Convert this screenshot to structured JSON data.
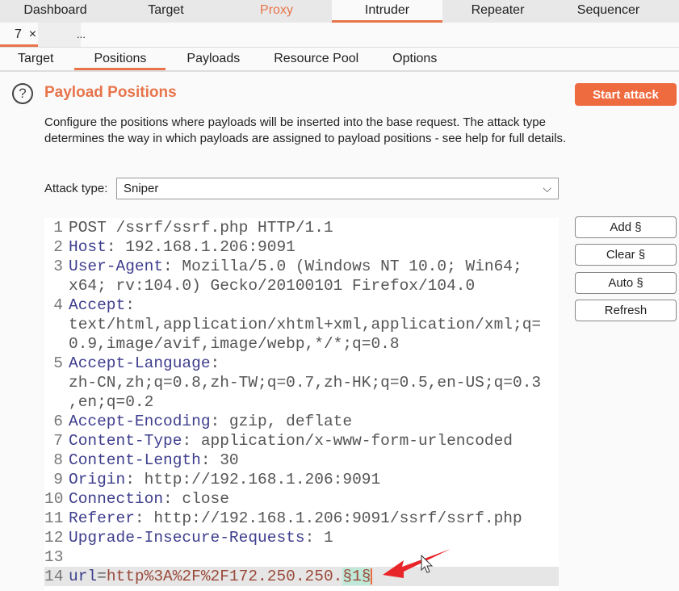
{
  "top_tabs": [
    "Dashboard",
    "Target",
    "Proxy",
    "Intruder",
    "Repeater",
    "Sequencer"
  ],
  "instance_tabs": {
    "current": "7",
    "close": "×",
    "more": "..."
  },
  "nav_tabs": [
    "Target",
    "Positions",
    "Payloads",
    "Resource Pool",
    "Options"
  ],
  "section": {
    "help_icon": "?",
    "title": "Payload Positions",
    "start_label": "Start attack",
    "description": "Configure the positions where payloads will be inserted into the base request. The attack type determines the way in which payloads are assigned to payload positions - see help for full details."
  },
  "attack_type": {
    "label": "Attack type:",
    "value": "Sniper"
  },
  "buttons": [
    "Add §",
    "Clear §",
    "Auto §",
    "Refresh"
  ],
  "colors": {
    "accent": "#e8744a",
    "payload_bg": "#bfe8d8"
  },
  "request_rows": [
    {
      "n": "1",
      "s": [
        [
          "val",
          "POST /ssrf/ssrf.php HTTP/1.1"
        ]
      ]
    },
    {
      "n": "2",
      "s": [
        [
          "key",
          "Host"
        ],
        [
          "val",
          ": 192.168.1.206:9091"
        ]
      ]
    },
    {
      "n": "3",
      "s": [
        [
          "key",
          "User-Agent"
        ],
        [
          "val",
          ": Mozilla/5.0 (Windows NT 10.0; Win64;"
        ]
      ]
    },
    {
      "n": "",
      "s": [
        [
          "val",
          "x64; rv:104.0) Gecko/20100101 Firefox/104.0"
        ]
      ]
    },
    {
      "n": "4",
      "s": [
        [
          "key",
          "Accept"
        ],
        [
          "val",
          ":"
        ]
      ]
    },
    {
      "n": "",
      "s": [
        [
          "val",
          "text/html,application/xhtml+xml,application/xml;q="
        ]
      ]
    },
    {
      "n": "",
      "s": [
        [
          "val",
          "0.9,image/avif,image/webp,*/*;q=0.8"
        ]
      ]
    },
    {
      "n": "5",
      "s": [
        [
          "key",
          "Accept-Language"
        ],
        [
          "val",
          ":"
        ]
      ]
    },
    {
      "n": "",
      "s": [
        [
          "val",
          "zh-CN,zh;q=0.8,zh-TW;q=0.7,zh-HK;q=0.5,en-US;q=0.3"
        ]
      ]
    },
    {
      "n": "",
      "s": [
        [
          "val",
          ",en;q=0.2"
        ]
      ]
    },
    {
      "n": "6",
      "s": [
        [
          "key",
          "Accept-Encoding"
        ],
        [
          "val",
          ": gzip, deflate"
        ]
      ]
    },
    {
      "n": "7",
      "s": [
        [
          "key",
          "Content-Type"
        ],
        [
          "val",
          ": application/x-www-form-urlencoded"
        ]
      ]
    },
    {
      "n": "8",
      "s": [
        [
          "key",
          "Content-Length"
        ],
        [
          "val",
          ": 30"
        ]
      ]
    },
    {
      "n": "9",
      "s": [
        [
          "key",
          "Origin"
        ],
        [
          "val",
          ": http://192.168.1.206:9091"
        ]
      ]
    },
    {
      "n": "10",
      "s": [
        [
          "key",
          "Connection"
        ],
        [
          "val",
          ": close"
        ]
      ]
    },
    {
      "n": "11",
      "s": [
        [
          "key",
          "Referer"
        ],
        [
          "val",
          ": http://192.168.1.206:9091/ssrf/ssrf.php"
        ]
      ]
    },
    {
      "n": "12",
      "s": [
        [
          "key",
          "Upgrade-Insecure-Requests"
        ],
        [
          "val",
          ": 1"
        ]
      ]
    },
    {
      "n": "13",
      "s": []
    },
    {
      "n": "14",
      "hl": true,
      "s": [
        [
          "key",
          "url"
        ],
        [
          "val",
          "="
        ],
        [
          "pval",
          "http%3A%2F%2F172.250.250."
        ],
        [
          "pay",
          "§1§"
        ]
      ]
    }
  ]
}
